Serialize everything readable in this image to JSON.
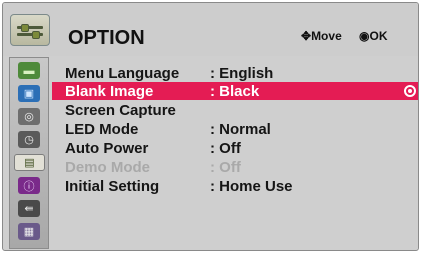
{
  "header": {
    "title": "OPTION",
    "move_hint": "Move",
    "ok_hint": "OK",
    "move_icon": "four-way-arrow-icon",
    "ok_icon": "ok-circle-icon"
  },
  "sidebar": {
    "items": [
      {
        "icon": "picture-icon",
        "glyph": "▬"
      },
      {
        "icon": "screen-icon",
        "glyph": "▣"
      },
      {
        "icon": "audio-icon",
        "glyph": "◎"
      },
      {
        "icon": "time-icon",
        "glyph": "◷"
      },
      {
        "icon": "option-icon",
        "glyph": "▤"
      },
      {
        "icon": "info-icon",
        "glyph": "ⓘ"
      },
      {
        "icon": "input-icon",
        "glyph": "⇚"
      },
      {
        "icon": "media-icon",
        "glyph": "▦"
      }
    ],
    "selected_index": 4
  },
  "menu": {
    "rows": [
      {
        "label": "Menu Language",
        "value": ": English",
        "state": "normal"
      },
      {
        "label": "Blank Image",
        "value": ": Black",
        "state": "selected"
      },
      {
        "label": "Screen Capture",
        "value": "",
        "state": "normal"
      },
      {
        "label": "LED Mode",
        "value": ": Normal",
        "state": "normal"
      },
      {
        "label": "Auto Power",
        "value": ": Off",
        "state": "normal"
      },
      {
        "label": "Demo Mode",
        "value": ": Off",
        "state": "disabled"
      },
      {
        "label": "Initial Setting",
        "value": ": Home Use",
        "state": "normal"
      }
    ]
  },
  "colors": {
    "highlight": "#e41c54",
    "panel": "#cfcfcf",
    "disabled_text": "#a9a9a9"
  }
}
